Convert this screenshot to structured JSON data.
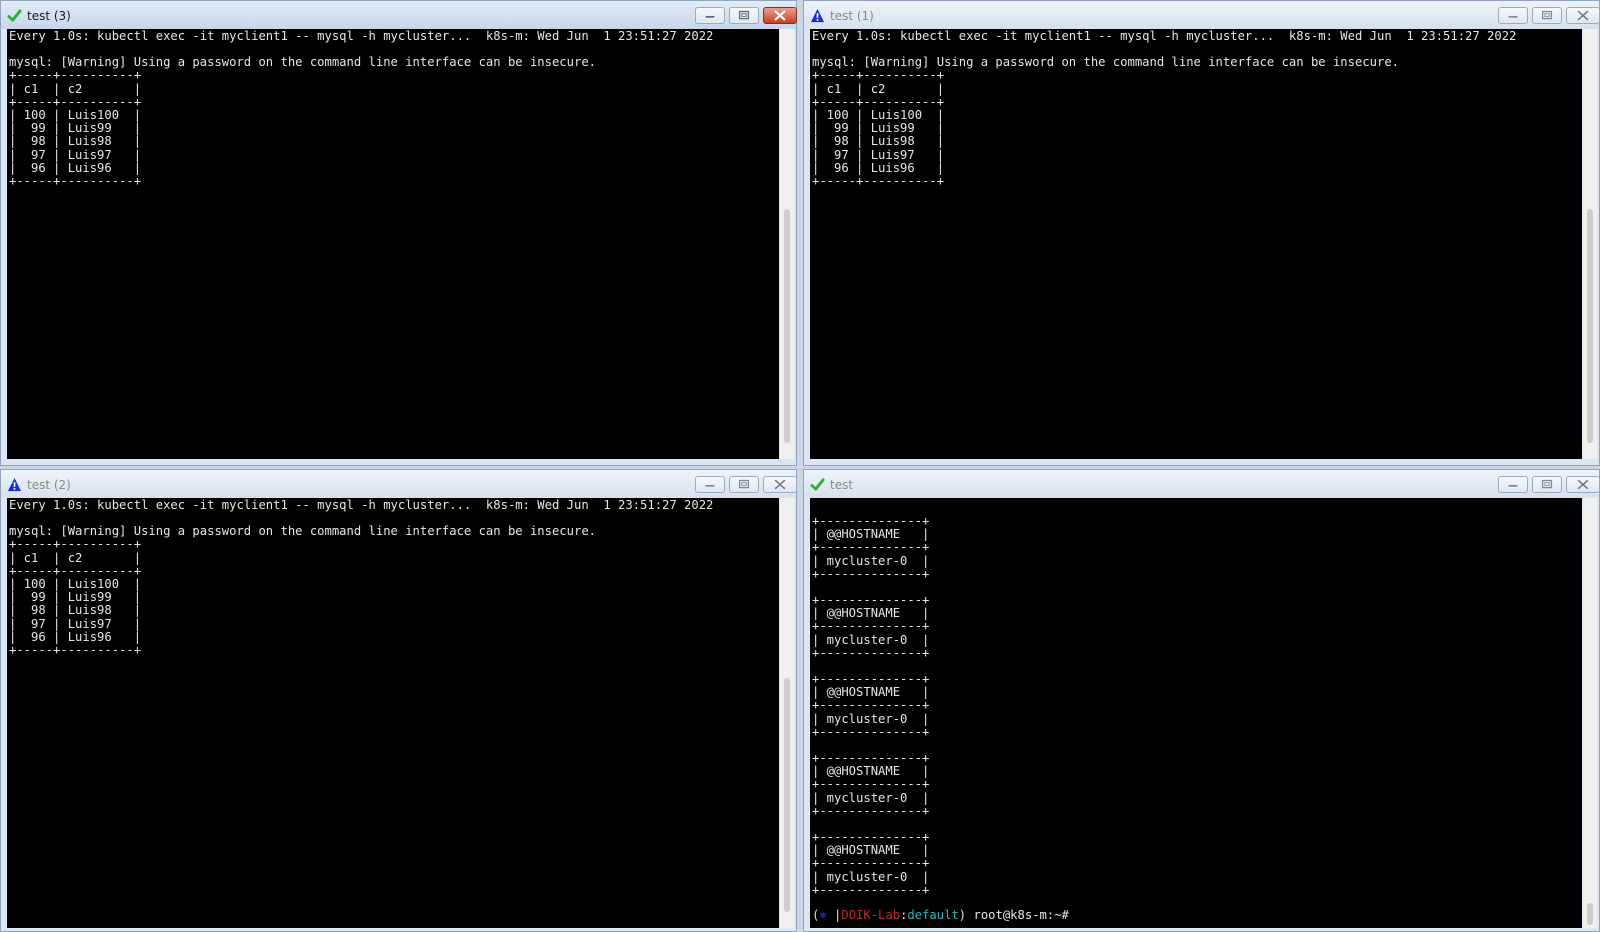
{
  "colors": {
    "terminal_background": "#000000",
    "terminal_text": "#e6e6e6",
    "prompt_icon": "#2233cc",
    "prompt_lab": "#c0292e",
    "prompt_namespace": "#2fb3b3",
    "success_icon": "#2fae2f",
    "warning_icon": "#1b2fc9"
  },
  "windows": [
    {
      "title": "test (3)",
      "status_icon": "checkmark-icon",
      "active": true,
      "header": "Every 1.0s: kubectl exec -it myclient1 -- mysql -h mycluster...  k8s-m: Wed Jun  1 23:51:27 2022",
      "warning": "mysql: [Warning] Using a password on the command line interface can be insecure.",
      "table": [
        "+-----+----------+",
        "| c1  | c2       |",
        "+-----+----------+",
        "| 100 | Luis100  |",
        "|  99 | Luis99   |",
        "|  98 | Luis98   |",
        "|  97 | Luis97   |",
        "|  96 | Luis96   |",
        "+-----+----------+"
      ]
    },
    {
      "title": "test (1)",
      "status_icon": "warning-triangle-icon",
      "active": false,
      "header": "Every 1.0s: kubectl exec -it myclient1 -- mysql -h mycluster...  k8s-m: Wed Jun  1 23:51:27 2022",
      "warning": "mysql: [Warning] Using a password on the command line interface can be insecure.",
      "table": [
        "+-----+----------+",
        "| c1  | c2       |",
        "+-----+----------+",
        "| 100 | Luis100  |",
        "|  99 | Luis99   |",
        "|  98 | Luis98   |",
        "|  97 | Luis97   |",
        "|  96 | Luis96   |",
        "+-----+----------+"
      ]
    },
    {
      "title": "test (2)",
      "status_icon": "warning-triangle-icon",
      "active": false,
      "header": "Every 1.0s: kubectl exec -it myclient1 -- mysql -h mycluster...  k8s-m: Wed Jun  1 23:51:27 2022",
      "warning": "mysql: [Warning] Using a password on the command line interface can be insecure.",
      "table": [
        "+-----+----------+",
        "| c1  | c2       |",
        "+-----+----------+",
        "| 100 | Luis100  |",
        "|  99 | Luis99   |",
        "|  98 | Luis98   |",
        "|  97 | Luis97   |",
        "|  96 | Luis96   |",
        "+-----+----------+"
      ]
    },
    {
      "title": "test",
      "status_icon": "checkmark-icon",
      "active": false,
      "host_blocks": [
        [
          "+--------------+",
          "| @@HOSTNAME   |",
          "+--------------+",
          "| mycluster-0  |",
          "+--------------+"
        ],
        [
          "+--------------+",
          "| @@HOSTNAME   |",
          "+--------------+",
          "| mycluster-0  |",
          "+--------------+"
        ],
        [
          "+--------------+",
          "| @@HOSTNAME   |",
          "+--------------+",
          "| mycluster-0  |",
          "+--------------+"
        ],
        [
          "+--------------+",
          "| @@HOSTNAME   |",
          "+--------------+",
          "| mycluster-0  |",
          "+--------------+"
        ],
        [
          "+--------------+",
          "| @@HOSTNAME   |",
          "+--------------+",
          "| mycluster-0  |",
          "+--------------+"
        ]
      ],
      "prompt": {
        "open": "(",
        "icon": "⎈",
        "separator": " |",
        "lab": "DOIK-Lab",
        "colon": ":",
        "namespace": "default",
        "close": ") ",
        "user_host": "root@k8s-m:~# "
      }
    }
  ]
}
